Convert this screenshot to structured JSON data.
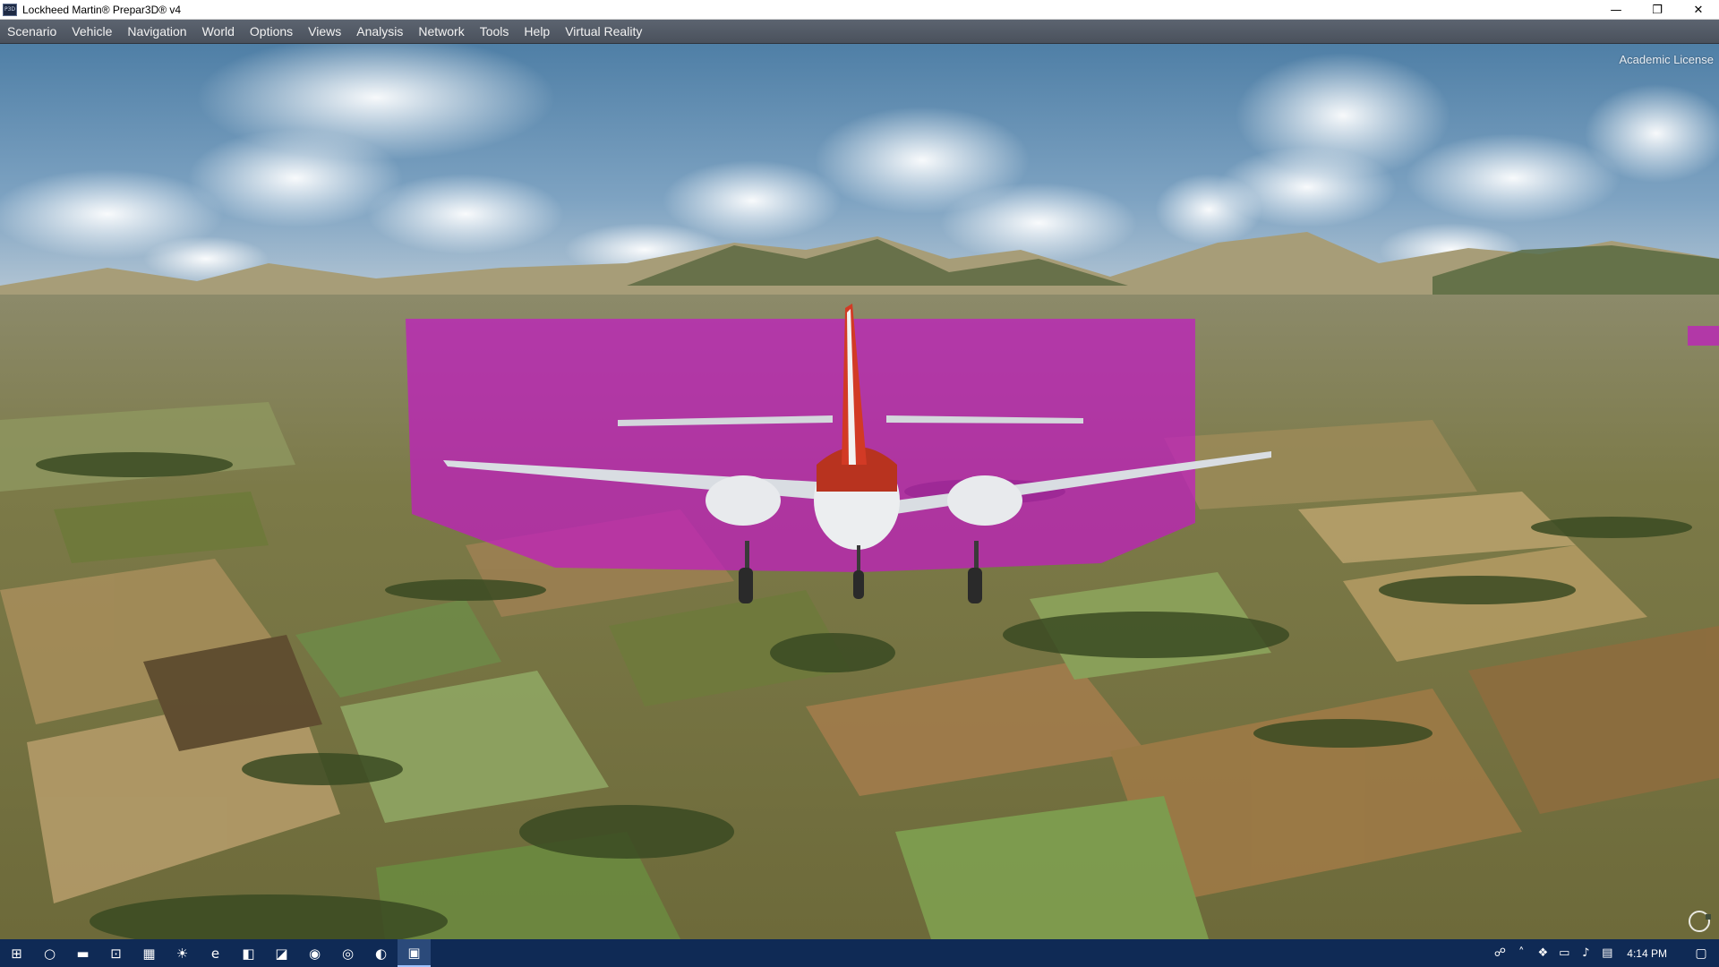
{
  "window": {
    "title": "Lockheed Martin® Prepar3D® v4",
    "icon_label": "P3D",
    "controls": {
      "minimize": "—",
      "restore": "❐",
      "close": "✕"
    }
  },
  "menu": [
    "Scenario",
    "Vehicle",
    "Navigation",
    "World",
    "Options",
    "Views",
    "Analysis",
    "Network",
    "Tools",
    "Help",
    "Virtual Reality"
  ],
  "viewport": {
    "license_text": "Academic License",
    "overlay_color": "#c21bc2",
    "sky_color": "#5f8db2",
    "ground_color": "#7a7a4a"
  },
  "taskbar": {
    "icons": [
      "windows-start-icon",
      "cortana-icon",
      "file-explorer-icon",
      "store-icon",
      "calendar-icon",
      "weather-icon",
      "edge-icon",
      "app-icon",
      "app-icon-2",
      "chrome-icon",
      "network-app-icon",
      "firefox-icon",
      "prepar3d-icon"
    ],
    "clock": "4:14 PM"
  }
}
